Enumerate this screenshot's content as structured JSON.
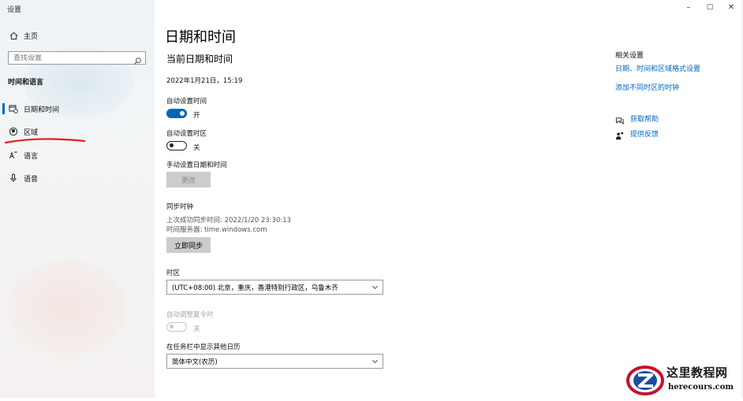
{
  "app": {
    "title": "设置"
  },
  "window_controls": {
    "minimize": "–",
    "maximize": "▢",
    "close": "✕"
  },
  "sidebar": {
    "home_label": "主页",
    "search_placeholder": "查找设置",
    "section_title": "时间和语言",
    "items": [
      {
        "label": "日期和时间",
        "icon": "calendar-clock-icon",
        "active": true
      },
      {
        "label": "区域",
        "icon": "globe-icon",
        "active": false
      },
      {
        "label": "语言",
        "icon": "language-icon",
        "active": false
      },
      {
        "label": "语音",
        "icon": "microphone-icon",
        "active": false
      }
    ]
  },
  "main": {
    "title": "日期和时间",
    "current_heading": "当前日期和时间",
    "current_datetime": "2022年1月21日，15:19",
    "auto_time": {
      "label": "自动设置时间",
      "state_text": "开",
      "on": true
    },
    "auto_timezone": {
      "label": "自动设置时区",
      "state_text": "关",
      "on": false
    },
    "manual": {
      "label": "手动设置日期和时间",
      "button": "更改"
    },
    "sync": {
      "heading": "同步时钟",
      "last_sync": "上次成功同步时间: 2022/1/20 23:30:13",
      "server": "时间服务器: time.windows.com",
      "button": "立即同步"
    },
    "timezone": {
      "label": "时区",
      "value": "(UTC+08:00) 北京，重庆，香港特别行政区，乌鲁木齐"
    },
    "dst": {
      "label": "自动调整夏令时",
      "state_text": "关",
      "on": false,
      "disabled": true
    },
    "calendar": {
      "label": "在任务栏中显示其他日历",
      "value": "简体中文(农历)"
    }
  },
  "related": {
    "heading": "相关设置",
    "links": [
      "日期、时间和区域格式设置",
      "添加不同时区的时钟"
    ],
    "help": {
      "label": "获取帮助",
      "icon": "help-chat-icon"
    },
    "feedback": {
      "label": "提供反馈",
      "icon": "feedback-person-icon"
    }
  },
  "watermark": {
    "name": "这里教程网",
    "url": "herecours.com"
  },
  "colors": {
    "accent": "#0067c0",
    "annotation": "#e02020",
    "watermark_red": "#c8102e"
  }
}
